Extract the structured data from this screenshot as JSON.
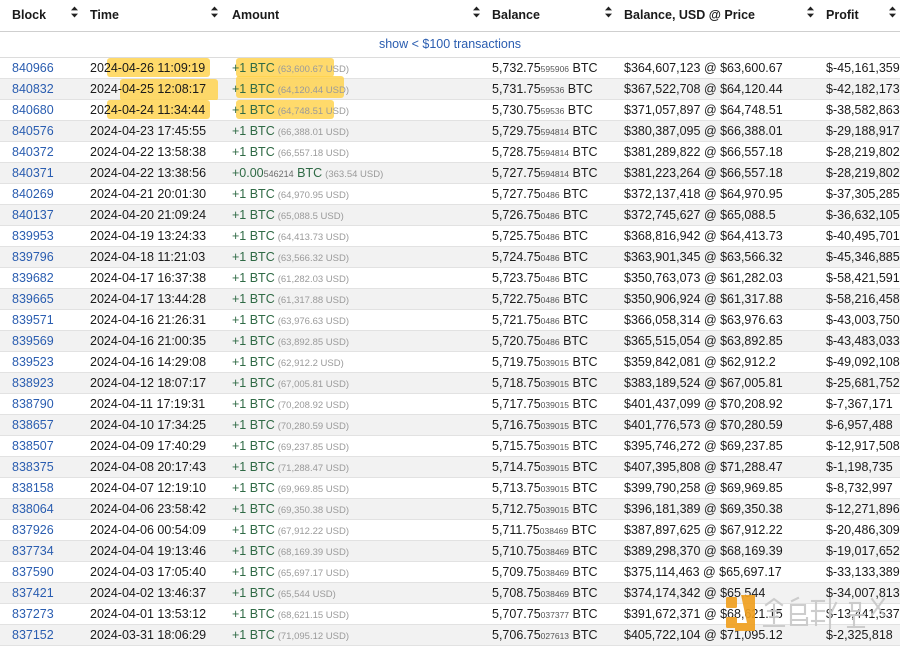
{
  "table": {
    "columns": [
      {
        "key": "block",
        "label": "Block",
        "sortable": true
      },
      {
        "key": "time",
        "label": "Time",
        "sortable": true
      },
      {
        "key": "amount",
        "label": "Amount",
        "sortable": true
      },
      {
        "key": "balance",
        "label": "Balance",
        "sortable": true
      },
      {
        "key": "busd",
        "label": "Balance, USD @ Price",
        "sortable": true
      },
      {
        "key": "profit",
        "label": "Profit",
        "sortable": true
      }
    ],
    "sort_icon": "sort-updown-icon",
    "notice": {
      "label": "show < $100 transactions"
    },
    "rows": [
      {
        "block": "840966",
        "time": "2024-04-26 11:09:19",
        "amt_main": "+1 BTC",
        "amt_sub": "",
        "amt_usd": "(63,600.67 USD)",
        "bal_main": "5,732.75",
        "bal_sub": "595906",
        "bal_unit": "BTC",
        "busd": "$364,607,123 @ $63,600.67",
        "profit": "$-45,161,359",
        "highlight_time": true,
        "highlight_amount": true
      },
      {
        "block": "840832",
        "time": "2024-04-25 12:08:17",
        "amt_main": "+1 BTC",
        "amt_sub": "",
        "amt_usd": "(64,120.44 USD)",
        "bal_main": "5,731.75",
        "bal_sub": "59536",
        "bal_unit": "BTC",
        "busd": "$367,522,708 @ $64,120.44",
        "profit": "$-42,182,173",
        "highlight_time": true,
        "highlight_amount": true
      },
      {
        "block": "840680",
        "time": "2024-04-24 11:34:44",
        "amt_main": "+1 BTC",
        "amt_sub": "",
        "amt_usd": "(64,748.51 USD)",
        "bal_main": "5,730.75",
        "bal_sub": "59536",
        "bal_unit": "BTC",
        "busd": "$371,057,897 @ $64,748.51",
        "profit": "$-38,582,863",
        "highlight_time": true,
        "highlight_amount": true
      },
      {
        "block": "840576",
        "time": "2024-04-23 17:45:55",
        "amt_main": "+1 BTC",
        "amt_sub": "",
        "amt_usd": "(66,388.01 USD)",
        "bal_main": "5,729.75",
        "bal_sub": "594814",
        "bal_unit": "BTC",
        "busd": "$380,387,095 @ $66,388.01",
        "profit": "$-29,188,917",
        "highlight_time": false,
        "highlight_amount": false
      },
      {
        "block": "840372",
        "time": "2024-04-22 13:58:38",
        "amt_main": "+1 BTC",
        "amt_sub": "",
        "amt_usd": "(66,557.18 USD)",
        "bal_main": "5,728.75",
        "bal_sub": "594814",
        "bal_unit": "BTC",
        "busd": "$381,289,822 @ $66,557.18",
        "profit": "$-28,219,802",
        "highlight_time": false,
        "highlight_amount": false
      },
      {
        "block": "840371",
        "time": "2024-04-22 13:38:56",
        "amt_main": "+0.00",
        "amt_sub": "546214",
        "amt_usd": "(363.54 USD)",
        "amt_unit": "BTC",
        "bal_main": "5,727.75",
        "bal_sub": "594814",
        "bal_unit": "BTC",
        "busd": "$381,223,264 @ $66,557.18",
        "profit": "$-28,219,802",
        "highlight_time": false,
        "highlight_amount": false
      },
      {
        "block": "840269",
        "time": "2024-04-21 20:01:30",
        "amt_main": "+1 BTC",
        "amt_sub": "",
        "amt_usd": "(64,970.95 USD)",
        "bal_main": "5,727.75",
        "bal_sub": "0486",
        "bal_unit": "BTC",
        "busd": "$372,137,418 @ $64,970.95",
        "profit": "$-37,305,285",
        "highlight_time": false,
        "highlight_amount": false
      },
      {
        "block": "840137",
        "time": "2024-04-20 21:09:24",
        "amt_main": "+1 BTC",
        "amt_sub": "",
        "amt_usd": "(65,088.5 USD)",
        "bal_main": "5,726.75",
        "bal_sub": "0486",
        "bal_unit": "BTC",
        "busd": "$372,745,627 @ $65,088.5",
        "profit": "$-36,632,105",
        "highlight_time": false,
        "highlight_amount": false
      },
      {
        "block": "839953",
        "time": "2024-04-19 13:24:33",
        "amt_main": "+1 BTC",
        "amt_sub": "",
        "amt_usd": "(64,413.73 USD)",
        "bal_main": "5,725.75",
        "bal_sub": "0486",
        "bal_unit": "BTC",
        "busd": "$368,816,942 @ $64,413.73",
        "profit": "$-40,495,701",
        "highlight_time": false,
        "highlight_amount": false
      },
      {
        "block": "839796",
        "time": "2024-04-18 11:21:03",
        "amt_main": "+1 BTC",
        "amt_sub": "",
        "amt_usd": "(63,566.32 USD)",
        "bal_main": "5,724.75",
        "bal_sub": "0486",
        "bal_unit": "BTC",
        "busd": "$363,901,345 @ $63,566.32",
        "profit": "$-45,346,885",
        "highlight_time": false,
        "highlight_amount": false
      },
      {
        "block": "839682",
        "time": "2024-04-17 16:37:38",
        "amt_main": "+1 BTC",
        "amt_sub": "",
        "amt_usd": "(61,282.03 USD)",
        "bal_main": "5,723.75",
        "bal_sub": "0486",
        "bal_unit": "BTC",
        "busd": "$350,763,073 @ $61,282.03",
        "profit": "$-58,421,591",
        "highlight_time": false,
        "highlight_amount": false
      },
      {
        "block": "839665",
        "time": "2024-04-17 13:44:28",
        "amt_main": "+1 BTC",
        "amt_sub": "",
        "amt_usd": "(61,317.88 USD)",
        "bal_main": "5,722.75",
        "bal_sub": "0486",
        "bal_unit": "BTC",
        "busd": "$350,906,924 @ $61,317.88",
        "profit": "$-58,216,458",
        "highlight_time": false,
        "highlight_amount": false
      },
      {
        "block": "839571",
        "time": "2024-04-16 21:26:31",
        "amt_main": "+1 BTC",
        "amt_sub": "",
        "amt_usd": "(63,976.63 USD)",
        "bal_main": "5,721.75",
        "bal_sub": "0486",
        "bal_unit": "BTC",
        "busd": "$366,058,314 @ $63,976.63",
        "profit": "$-43,003,750",
        "highlight_time": false,
        "highlight_amount": false
      },
      {
        "block": "839569",
        "time": "2024-04-16 21:00:35",
        "amt_main": "+1 BTC",
        "amt_sub": "",
        "amt_usd": "(63,892.85 USD)",
        "bal_main": "5,720.75",
        "bal_sub": "0486",
        "bal_unit": "BTC",
        "busd": "$365,515,054 @ $63,892.85",
        "profit": "$-43,483,033",
        "highlight_time": false,
        "highlight_amount": false
      },
      {
        "block": "839523",
        "time": "2024-04-16 14:29:08",
        "amt_main": "+1 BTC",
        "amt_sub": "",
        "amt_usd": "(62,912.2 USD)",
        "bal_main": "5,719.75",
        "bal_sub": "039015",
        "bal_unit": "BTC",
        "busd": "$359,842,081 @ $62,912.2",
        "profit": "$-49,092,108",
        "highlight_time": false,
        "highlight_amount": false
      },
      {
        "block": "838923",
        "time": "2024-04-12 18:07:17",
        "amt_main": "+1 BTC",
        "amt_sub": "",
        "amt_usd": "(67,005.81 USD)",
        "bal_main": "5,718.75",
        "bal_sub": "039015",
        "bal_unit": "BTC",
        "busd": "$383,189,524 @ $67,005.81",
        "profit": "$-25,681,752",
        "highlight_time": false,
        "highlight_amount": false
      },
      {
        "block": "838790",
        "time": "2024-04-11 17:19:31",
        "amt_main": "+1 BTC",
        "amt_sub": "",
        "amt_usd": "(70,208.92 USD)",
        "bal_main": "5,717.75",
        "bal_sub": "039015",
        "bal_unit": "BTC",
        "busd": "$401,437,099 @ $70,208.92",
        "profit": "$-7,367,171",
        "highlight_time": false,
        "highlight_amount": false
      },
      {
        "block": "838657",
        "time": "2024-04-10 17:34:25",
        "amt_main": "+1 BTC",
        "amt_sub": "",
        "amt_usd": "(70,280.59 USD)",
        "bal_main": "5,716.75",
        "bal_sub": "039015",
        "bal_unit": "BTC",
        "busd": "$401,776,573 @ $70,280.59",
        "profit": "$-6,957,488",
        "highlight_time": false,
        "highlight_amount": false
      },
      {
        "block": "838507",
        "time": "2024-04-09 17:40:29",
        "amt_main": "+1 BTC",
        "amt_sub": "",
        "amt_usd": "(69,237.85 USD)",
        "bal_main": "5,715.75",
        "bal_sub": "039015",
        "bal_unit": "BTC",
        "busd": "$395,746,272 @ $69,237.85",
        "profit": "$-12,917,508",
        "highlight_time": false,
        "highlight_amount": false
      },
      {
        "block": "838375",
        "time": "2024-04-08 20:17:43",
        "amt_main": "+1 BTC",
        "amt_sub": "",
        "amt_usd": "(71,288.47 USD)",
        "bal_main": "5,714.75",
        "bal_sub": "039015",
        "bal_unit": "BTC",
        "busd": "$407,395,808 @ $71,288.47",
        "profit": "$-1,198,735",
        "highlight_time": false,
        "highlight_amount": false
      },
      {
        "block": "838158",
        "time": "2024-04-07 12:19:10",
        "amt_main": "+1 BTC",
        "amt_sub": "",
        "amt_usd": "(69,969.85 USD)",
        "bal_main": "5,713.75",
        "bal_sub": "039015",
        "bal_unit": "BTC",
        "busd": "$399,790,258 @ $69,969.85",
        "profit": "$-8,732,997",
        "highlight_time": false,
        "highlight_amount": false
      },
      {
        "block": "838064",
        "time": "2024-04-06 23:58:42",
        "amt_main": "+1 BTC",
        "amt_sub": "",
        "amt_usd": "(69,350.38 USD)",
        "bal_main": "5,712.75",
        "bal_sub": "039015",
        "bal_unit": "BTC",
        "busd": "$396,181,389 @ $69,350.38",
        "profit": "$-12,271,896",
        "highlight_time": false,
        "highlight_amount": false
      },
      {
        "block": "837926",
        "time": "2024-04-06 00:54:09",
        "amt_main": "+1 BTC",
        "amt_sub": "",
        "amt_usd": "(67,912.22 USD)",
        "bal_main": "5,711.75",
        "bal_sub": "038469",
        "bal_unit": "BTC",
        "busd": "$387,897,625 @ $67,912.22",
        "profit": "$-20,486,309",
        "highlight_time": false,
        "highlight_amount": false
      },
      {
        "block": "837734",
        "time": "2024-04-04 19:13:46",
        "amt_main": "+1 BTC",
        "amt_sub": "",
        "amt_usd": "(68,169.39 USD)",
        "bal_main": "5,710.75",
        "bal_sub": "038469",
        "bal_unit": "BTC",
        "busd": "$389,298,370 @ $68,169.39",
        "profit": "$-19,017,652",
        "highlight_time": false,
        "highlight_amount": false
      },
      {
        "block": "837590",
        "time": "2024-04-03 17:05:40",
        "amt_main": "+1 BTC",
        "amt_sub": "",
        "amt_usd": "(65,697.17 USD)",
        "bal_main": "5,709.75",
        "bal_sub": "038469",
        "bal_unit": "BTC",
        "busd": "$375,114,463 @ $65,697.17",
        "profit": "$-33,133,389",
        "highlight_time": false,
        "highlight_amount": false
      },
      {
        "block": "837421",
        "time": "2024-04-02 13:46:37",
        "amt_main": "+1 BTC",
        "amt_sub": "",
        "amt_usd": "(65,544 USD)",
        "bal_main": "5,708.75",
        "bal_sub": "038469",
        "bal_unit": "BTC",
        "busd": "$374,174,342 @ $65,544",
        "profit": "$-34,007,813",
        "highlight_time": false,
        "highlight_amount": false
      },
      {
        "block": "837273",
        "time": "2024-04-01 13:53:12",
        "amt_main": "+1 BTC",
        "amt_sub": "",
        "amt_usd": "(68,621.15 USD)",
        "bal_main": "5,707.75",
        "bal_sub": "037377",
        "bal_unit": "BTC",
        "busd": "$391,672,371 @ $68,621.15",
        "profit": "$-13,441,537",
        "highlight_time": false,
        "highlight_amount": false
      },
      {
        "block": "837152",
        "time": "2024-03-31 18:06:29",
        "amt_main": "+1 BTC",
        "amt_sub": "",
        "amt_usd": "(71,095.12 USD)",
        "bal_main": "5,706.75",
        "bal_sub": "027613",
        "bal_unit": "BTC",
        "busd": "$405,722,104 @ $71,095.12",
        "profit": "$-2,325,818",
        "highlight_time": false,
        "highlight_amount": false
      }
    ]
  },
  "watermark": {
    "text": "金色财经",
    "logo_color": "#f0a020",
    "text_color": "#c9c9c9"
  },
  "colors": {
    "link": "#2a5db0",
    "amount_green": "#2f6a45",
    "highlight_yellow": "#ffd24a",
    "row_stripe": "#f2f2f2"
  }
}
